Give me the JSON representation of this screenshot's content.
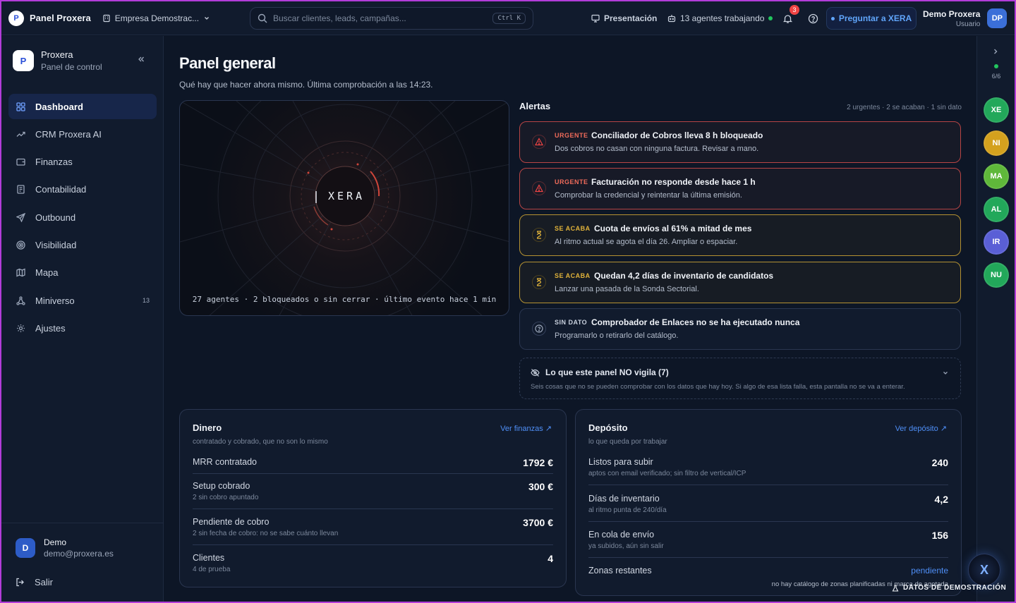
{
  "topbar": {
    "app_title": "Panel Proxera",
    "logo_letter": "P",
    "company": "Empresa Demostrac...",
    "search_placeholder": "Buscar clientes, leads, campañas...",
    "search_shortcut": "Ctrl K",
    "presentation": "Presentación",
    "agents_working": "13 agentes trabajando",
    "notifications_count": "3",
    "ask_xera": "Preguntar a XERA",
    "user_name": "Demo Proxera",
    "user_role": "Usuario",
    "user_initials": "DP"
  },
  "sidebar": {
    "brand_name": "Proxera",
    "brand_sub": "Panel de control",
    "brand_letter": "P",
    "items": [
      {
        "label": "Dashboard"
      },
      {
        "label": "CRM Proxera AI"
      },
      {
        "label": "Finanzas"
      },
      {
        "label": "Contabilidad"
      },
      {
        "label": "Outbound"
      },
      {
        "label": "Visibilidad"
      },
      {
        "label": "Mapa"
      },
      {
        "label": "Miniverso",
        "count": "13"
      },
      {
        "label": "Ajustes"
      }
    ],
    "user_initial": "D",
    "user_name": "Demo",
    "user_email": "demo@proxera.es",
    "logout": "Salir"
  },
  "main": {
    "title": "Panel general",
    "subtitle": "Qué hay que hacer ahora mismo. Última comprobación a las 14:23.",
    "xera_label": "XERA",
    "xera_footer": "27 agentes · 2 bloqueados o sin cerrar · último evento hace 1 min",
    "alerts_title": "Alertas",
    "alerts_summary": "2 urgentes · 2 se acaban · 1 sin dato",
    "alerts": [
      {
        "tag": "URGENTE",
        "title": "Conciliador de Cobros lleva 8 h bloqueado",
        "desc": "Dos cobros no casan con ninguna factura. Revisar a mano."
      },
      {
        "tag": "URGENTE",
        "title": "Facturación no responde desde hace 1 h",
        "desc": "Comprobar la credencial y reintentar la última emisión."
      },
      {
        "tag": "SE ACABA",
        "title": "Cuota de envíos al 61% a mitad de mes",
        "desc": "Al ritmo actual se agota el día 26. Ampliar o espaciar."
      },
      {
        "tag": "SE ACABA",
        "title": "Quedan 4,2 días de inventario de candidatos",
        "desc": "Lanzar una pasada de la Sonda Sectorial."
      },
      {
        "tag": "SIN DATO",
        "title": "Comprobador de Enlaces no se ha ejecutado nunca",
        "desc": "Programarlo o retirarlo del catálogo."
      }
    ],
    "unwatched_title": "Lo que este panel NO vigila (7)",
    "unwatched_desc": "Seis cosas que no se pueden comprobar con los datos que hay hoy. Si algo de esa lista falla, esta pantalla no se va a enterar."
  },
  "money": {
    "title": "Dinero",
    "subtitle": "contratado y cobrado, que no son lo mismo",
    "link": "Ver finanzas",
    "rows": [
      {
        "label": "MRR contratado",
        "note": "",
        "value": "1792 €"
      },
      {
        "label": "Setup cobrado",
        "note": "2 sin cobro apuntado",
        "value": "300 €"
      },
      {
        "label": "Pendiente de cobro",
        "note": "2 sin fecha de cobro: no se sabe cuánto llevan",
        "value": "3700 €"
      },
      {
        "label": "Clientes",
        "note": "4 de prueba",
        "value": "4"
      }
    ]
  },
  "deposit": {
    "title": "Depósito",
    "subtitle": "lo que queda por trabajar",
    "link": "Ver depósito",
    "rows": [
      {
        "label": "Listos para subir",
        "note": "aptos con email verificado; sin filtro de vertical/ICP",
        "value": "240"
      },
      {
        "label": "Días de inventario",
        "note": "al ritmo punta de 240/día",
        "value": "4,2"
      },
      {
        "label": "En cola de envío",
        "note": "ya subidos, aún sin salir",
        "value": "156"
      },
      {
        "label": "Zonas restantes",
        "note": "no hay catálogo de zonas planificadas ni marca de agotada",
        "value": "pendiente"
      }
    ]
  },
  "rail": {
    "count": "6/6",
    "agents": [
      {
        "initials": "XE",
        "color": "#22a85a"
      },
      {
        "initials": "NI",
        "color": "#d4a11e"
      },
      {
        "initials": "MA",
        "color": "#5fb83a"
      },
      {
        "initials": "AL",
        "color": "#22a85a"
      },
      {
        "initials": "IR",
        "color": "#5a5fd6"
      },
      {
        "initials": "NU",
        "color": "#22a85a"
      }
    ]
  },
  "demo_flag": "DATOS DE DEMOSTRACIÓN",
  "fab_letter": "X",
  "colors": {
    "accent": "#4f8ff7",
    "urgent": "#ef4444",
    "warning": "#e0b23a",
    "ok": "#22c55e"
  }
}
